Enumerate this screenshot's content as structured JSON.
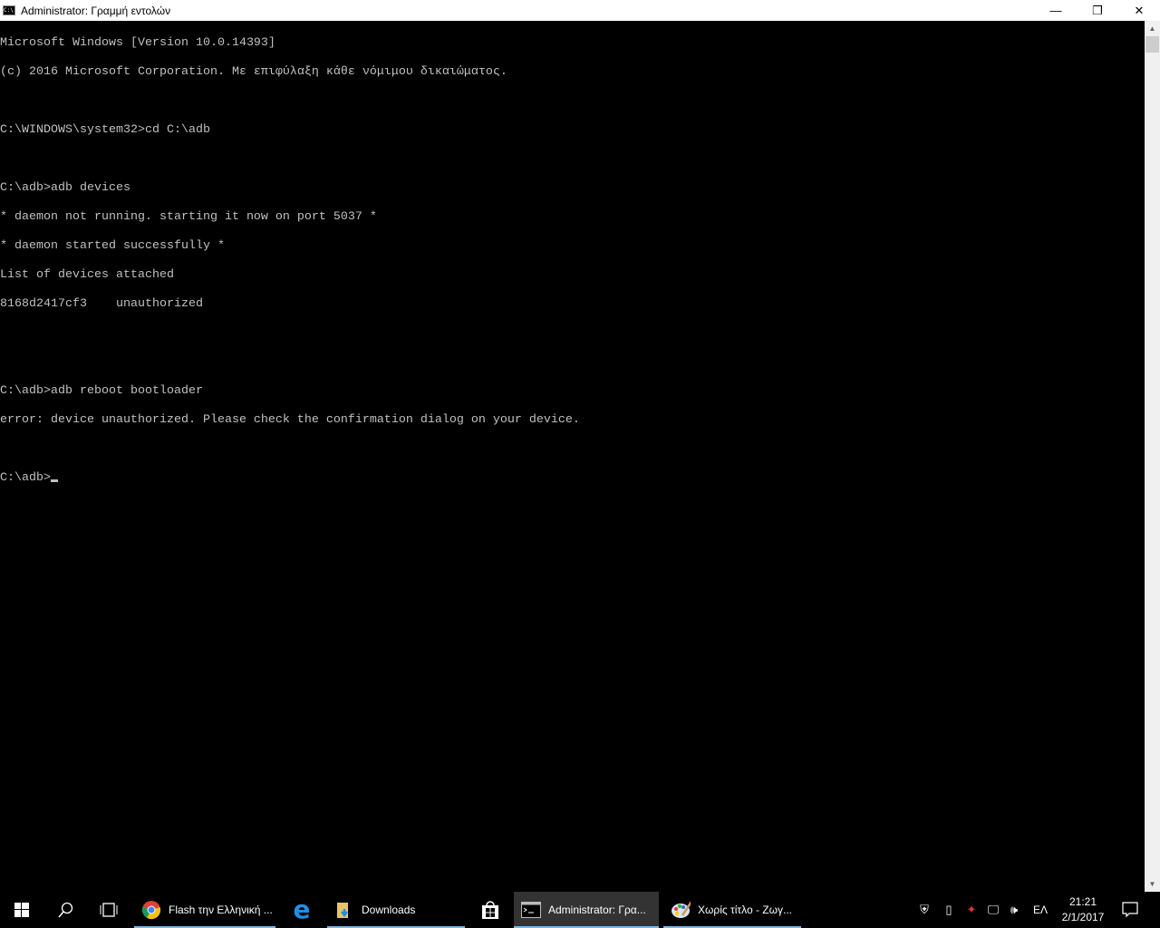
{
  "window": {
    "title": "Administrator: Γραμμή εντολών",
    "minimize": "—",
    "maximize": "❐",
    "close": "✕"
  },
  "console": {
    "lines": [
      "Microsoft Windows [Version 10.0.14393]",
      "(c) 2016 Microsoft Corporation. Με επιφύλαξη κάθε νόμιμου δικαιώματος.",
      "",
      "C:\\WINDOWS\\system32>cd C:\\adb",
      "",
      "C:\\adb>adb devices",
      "* daemon not running. starting it now on port 5037 *",
      "* daemon started successfully *",
      "List of devices attached",
      "8168d2417cf3    unauthorized",
      "",
      "",
      "C:\\adb>adb reboot bootloader",
      "error: device unauthorized. Please check the confirmation dialog on your device.",
      "",
      "C:\\adb>"
    ]
  },
  "taskbar": {
    "apps": [
      {
        "label": "Flash την Ελληνική ..."
      },
      {
        "label": ""
      },
      {
        "label": "Downloads"
      },
      {
        "label": ""
      },
      {
        "label": "Administrator: Γρα..."
      },
      {
        "label": "Χωρίς τίτλο - Ζωγ..."
      }
    ],
    "language": "ΕΛ",
    "time": "21:21",
    "date": "2/1/2017"
  }
}
